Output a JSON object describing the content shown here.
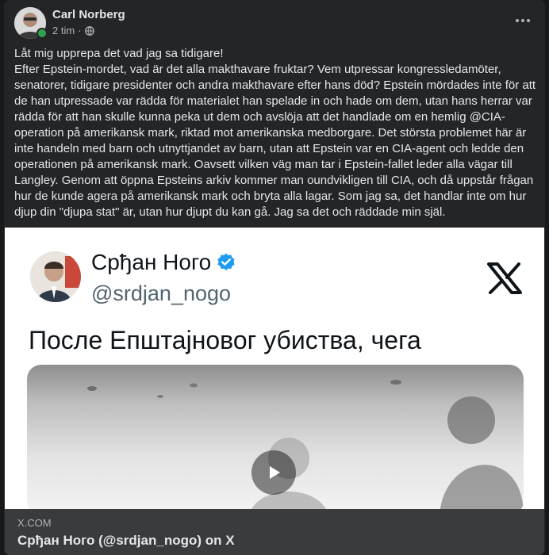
{
  "post": {
    "author": "Carl Norberg",
    "time": "2 tim",
    "separator": "·",
    "body": "Låt mig upprepa det vad jag sa tidigare!\nEfter Epstein-mordet, vad är det alla makthavare fruktar? Vem utpressar kongressledamöter, senatorer, tidigare presidenter och andra makthavare efter hans död? Epstein mördades inte för att de han utpressade var rädda för materialet han spelade in och hade om dem, utan hans herrar var rädda för att han skulle kunna peka ut dem och avslöja att det handlade om en hemlig @CIA-operation på amerikansk mark, riktad mot amerikanska medborgare. Det största problemet här är inte handeln med barn och utnyttjandet av barn, utan att Epstein var en CIA-agent och ledde den operationen på amerikansk mark. Oavsett vilken väg man tar i Epstein-fallet leder alla vägar till Langley. Genom att öppna Epsteins arkiv kommer man oundvikligen till CIA, och då uppstår frågan hur de kunde agera på amerikansk mark och bryta alla lagar. Som jag sa, det handlar inte om hur djup din \"djupa stat\" är, utan hur djupt du kan gå. Jag sa det och räddade min själ."
  },
  "preview": {
    "display_name": "Срђан Ного",
    "handle": "@srdjan_nogo",
    "tweet_text": "После Епштајновог убиства, чега"
  },
  "link_card": {
    "domain": "X.COM",
    "title": "Срђан Ного (@srdjan_nogo) on X"
  },
  "colors": {
    "card_bg": "#242526",
    "footer_bg": "#3a3b3c",
    "verified_blue": "#1d9bf0",
    "online_green": "#31a24c"
  }
}
